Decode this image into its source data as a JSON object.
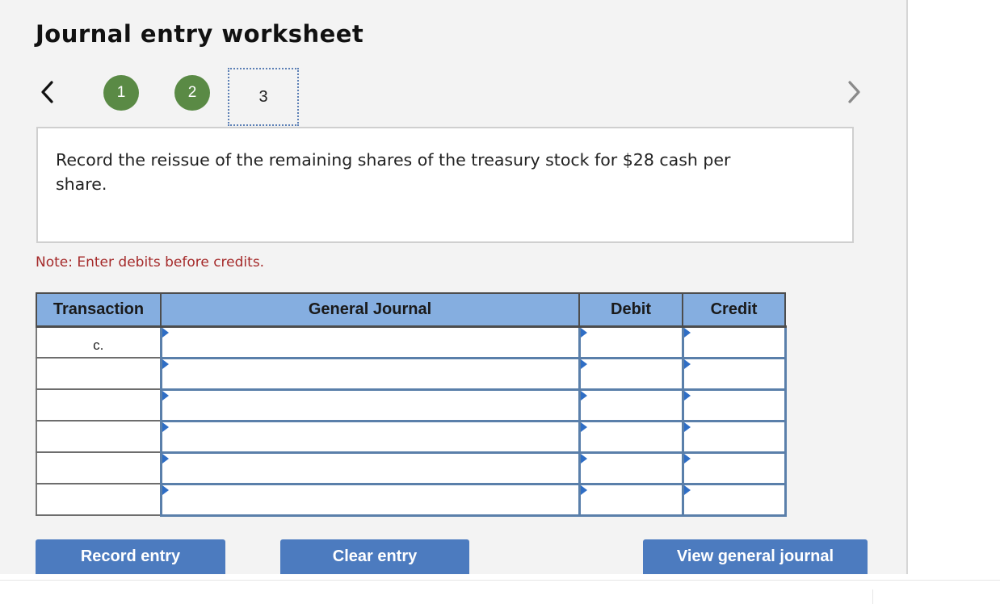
{
  "title": "Journal entry worksheet",
  "nav": {
    "steps": [
      "1",
      "2",
      "3"
    ],
    "current_step": "3"
  },
  "prompt": "Record the reissue of the remaining shares of the treasury stock for $28 cash per share.",
  "note": "Note: Enter debits before credits.",
  "table": {
    "headers": {
      "transaction": "Transaction",
      "general_journal": "General Journal",
      "debit": "Debit",
      "credit": "Credit"
    },
    "rows": [
      {
        "transaction": "c.",
        "account": "",
        "debit": "",
        "credit": ""
      },
      {
        "transaction": "",
        "account": "",
        "debit": "",
        "credit": ""
      },
      {
        "transaction": "",
        "account": "",
        "debit": "",
        "credit": ""
      },
      {
        "transaction": "",
        "account": "",
        "debit": "",
        "credit": ""
      },
      {
        "transaction": "",
        "account": "",
        "debit": "",
        "credit": ""
      },
      {
        "transaction": "",
        "account": "",
        "debit": "",
        "credit": ""
      }
    ]
  },
  "buttons": {
    "record": "Record entry",
    "clear": "Clear entry",
    "view": "View general journal"
  },
  "colors": {
    "step_done": "#5a8a45",
    "header": "#85aee0",
    "button": "#4c7bbf",
    "note": "#a52a2a"
  },
  "icons": {
    "prev": "chevron-left-icon",
    "next": "chevron-right-icon",
    "row_marker": "triangle-marker-icon"
  }
}
